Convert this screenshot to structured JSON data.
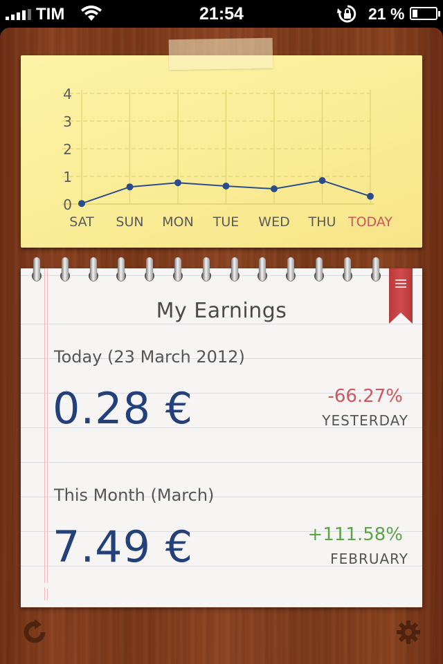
{
  "status_bar": {
    "carrier": "TIM",
    "time": "21:54",
    "battery_percent": "21 %",
    "battery_level": 0.21,
    "icons": [
      "signal-icon",
      "wifi-icon",
      "rotation-lock-icon",
      "battery-icon"
    ]
  },
  "chart_data": {
    "type": "line",
    "categories": [
      "SAT",
      "SUN",
      "MON",
      "TUE",
      "WED",
      "THU",
      "TODAY"
    ],
    "values": [
      0.02,
      0.62,
      0.77,
      0.65,
      0.55,
      0.85,
      0.28
    ],
    "ylim": [
      0,
      4
    ],
    "yticks": [
      "0",
      "1",
      "2",
      "3",
      "4"
    ],
    "highlight_category": "TODAY",
    "grid": true,
    "colors": {
      "line": "#2b4d8c",
      "axis_text": "#5a5a5a",
      "highlight_text": "#c9575a",
      "grid": "#e6d67a"
    }
  },
  "notebook": {
    "title": "My Earnings",
    "today": {
      "label": "Today (23 March 2012)",
      "value": "0.28 €",
      "change": "-66.27%",
      "compare": "YESTERDAY"
    },
    "month": {
      "label": "This Month (March)",
      "value": "7.49 €",
      "change": "+111.58%",
      "compare": "FEBRUARY"
    },
    "colors": {
      "value": "#24407a",
      "negative": "#d0555c",
      "positive": "#5fa24a"
    }
  },
  "toolbar": {
    "left_icon": "refresh-icon",
    "right_icon": "gear-icon"
  }
}
